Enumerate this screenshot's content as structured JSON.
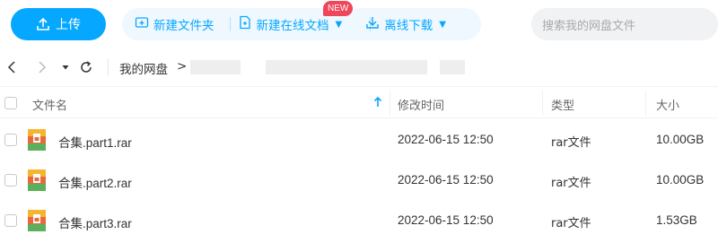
{
  "toolbar": {
    "upload_label": "上传",
    "new_folder_label": "新建文件夹",
    "new_online_doc_label": "新建在线文档",
    "new_badge": "NEW",
    "offline_download_label": "离线下载",
    "search_placeholder": "搜索我的网盘文件"
  },
  "breadcrumb": {
    "root": "我的网盘",
    "separator": ">"
  },
  "table": {
    "headers": {
      "name": "文件名",
      "modified": "修改时间",
      "type": "类型",
      "size": "大小"
    },
    "rows": [
      {
        "name": "合集.part1.rar",
        "modified": "2022-06-15 12:50",
        "type": "rar文件",
        "size": "10.00GB"
      },
      {
        "name": "合集.part2.rar",
        "modified": "2022-06-15 12:50",
        "type": "rar文件",
        "size": "10.00GB"
      },
      {
        "name": "合集.part3.rar",
        "modified": "2022-06-15 12:50",
        "type": "rar文件",
        "size": "1.53GB"
      }
    ]
  },
  "colors": {
    "accent": "#06a7ff",
    "badge": "#f0465a"
  },
  "icons": [
    "upload-icon",
    "new-folder-icon",
    "new-doc-icon",
    "download-icon",
    "back-icon",
    "forward-icon",
    "dropdown-icon",
    "refresh-icon",
    "sort-up-icon",
    "rar-file-icon"
  ]
}
